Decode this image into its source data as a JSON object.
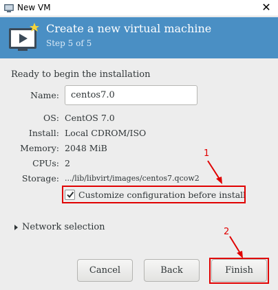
{
  "window": {
    "title": "New VM"
  },
  "banner": {
    "heading": "Create a new virtual machine",
    "step": "Step 5 of 5"
  },
  "summary": {
    "ready_text": "Ready to begin the installation",
    "name_label": "Name:",
    "name_value": "centos7.0",
    "os_label": "OS:",
    "os_value": "CentOS 7.0",
    "install_label": "Install:",
    "install_value": "Local CDROM/ISO",
    "memory_label": "Memory:",
    "memory_value": "2048 MiB",
    "cpus_label": "CPUs:",
    "cpus_value": "2",
    "storage_label": "Storage:",
    "storage_value": ".../lib/libvirt/images/centos7.qcow2"
  },
  "customize": {
    "label": "Customize configuration before install",
    "checked": true
  },
  "network": {
    "label": "Network selection"
  },
  "buttons": {
    "cancel": "Cancel",
    "back": "Back",
    "finish": "Finish"
  },
  "annotations": {
    "one": "1",
    "two": "2"
  },
  "colors": {
    "banner": "#4a8fc4",
    "highlight": "#e00000"
  }
}
